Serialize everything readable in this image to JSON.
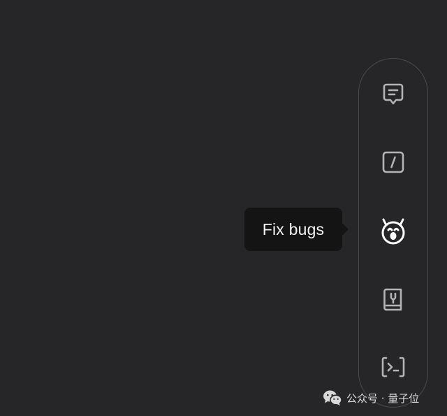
{
  "toolbar": {
    "items": [
      {
        "icon": "chat-bubble-icon"
      },
      {
        "icon": "slash-command-icon"
      },
      {
        "icon": "bug-icon",
        "active": true
      },
      {
        "icon": "book-icon"
      },
      {
        "icon": "terminal-icon"
      }
    ]
  },
  "tooltip": {
    "text": "Fix bugs"
  },
  "watermark": {
    "icon": "wechat-icon",
    "text": "公众号 · 量子位"
  },
  "colors": {
    "background": "#262628",
    "toolbar_border": "#4a4a4d",
    "icon_inactive": "#b4b4b6",
    "icon_active": "#ffffff",
    "tooltip_bg": "#141414",
    "tooltip_text": "#f2f2f2"
  }
}
